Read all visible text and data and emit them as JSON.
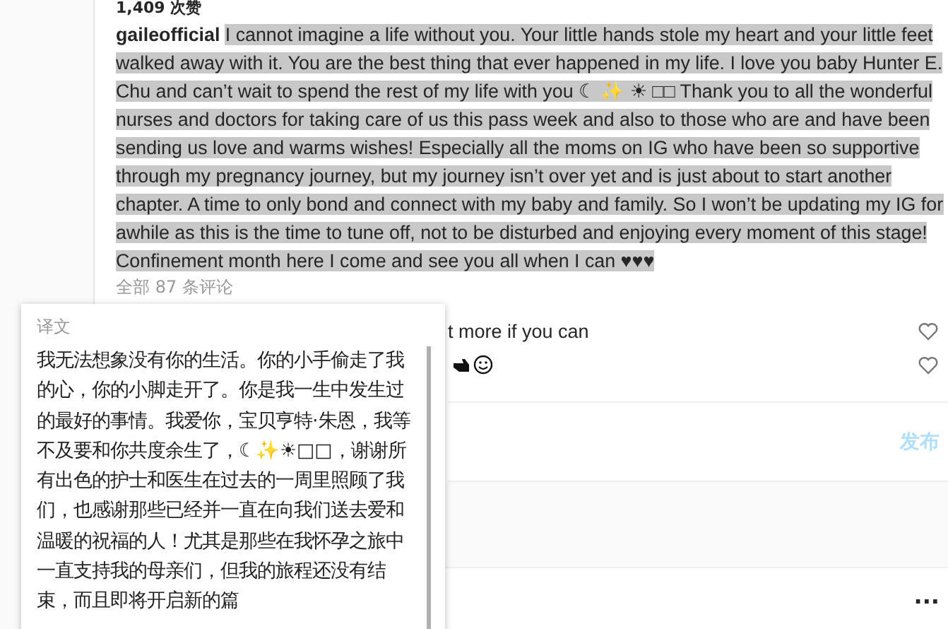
{
  "likes": "1,409 次赞",
  "post": {
    "username": "gaileofficial",
    "caption": "I cannot imagine a life without you. Your little hands stole my heart and your little feet walked away with it. You are the best thing that ever happened in my life. I love you baby Hunter E. Chu and can’t wait to spend the rest of my life with you ☾ ✨ ☀ □□ Thank you to all the wonderful nurses and doctors for taking care of us this pass week and also to those who are and have been sending us love and warms wishes! Especially all the moms on IG who have been so supportive through my pregnancy journey, but my journey isn’t over yet and is just about to start another chapter. A time to only bond and connect with my baby and family. So I won’t be updating my IG for awhile as this is the time to tune off, not to be disturbed and enjoying every moment of this stage! Confinement month here I come and see you all when I can ♥♥♥",
    "highlighted": true
  },
  "comments_link": "全部 87 条评论",
  "comments": [
    {
      "kind": "text",
      "text": "t more if you can"
    },
    {
      "kind": "emoji"
    }
  ],
  "comment_box": {
    "button": "发布"
  },
  "more_button": "...",
  "translation": {
    "title": "译文",
    "text": "我无法想象没有你的生活。你的小手偷走了我的心，你的小脚走开了。你是我一生中发生过的最好的事情。我爱你，宝贝亨特·朱恩，我等不及要和你共度余生了，☾✨☀□□，谢谢所有出色的护士和医生在过去的一周里照顾了我们，也感谢那些已经并一直在向我们送去爱和温暖的祝福的人！尤其是那些在我怀孕之旅中一直支持我的母亲们，但我的旅程还没有结束，而且即将开启新的篇"
  }
}
